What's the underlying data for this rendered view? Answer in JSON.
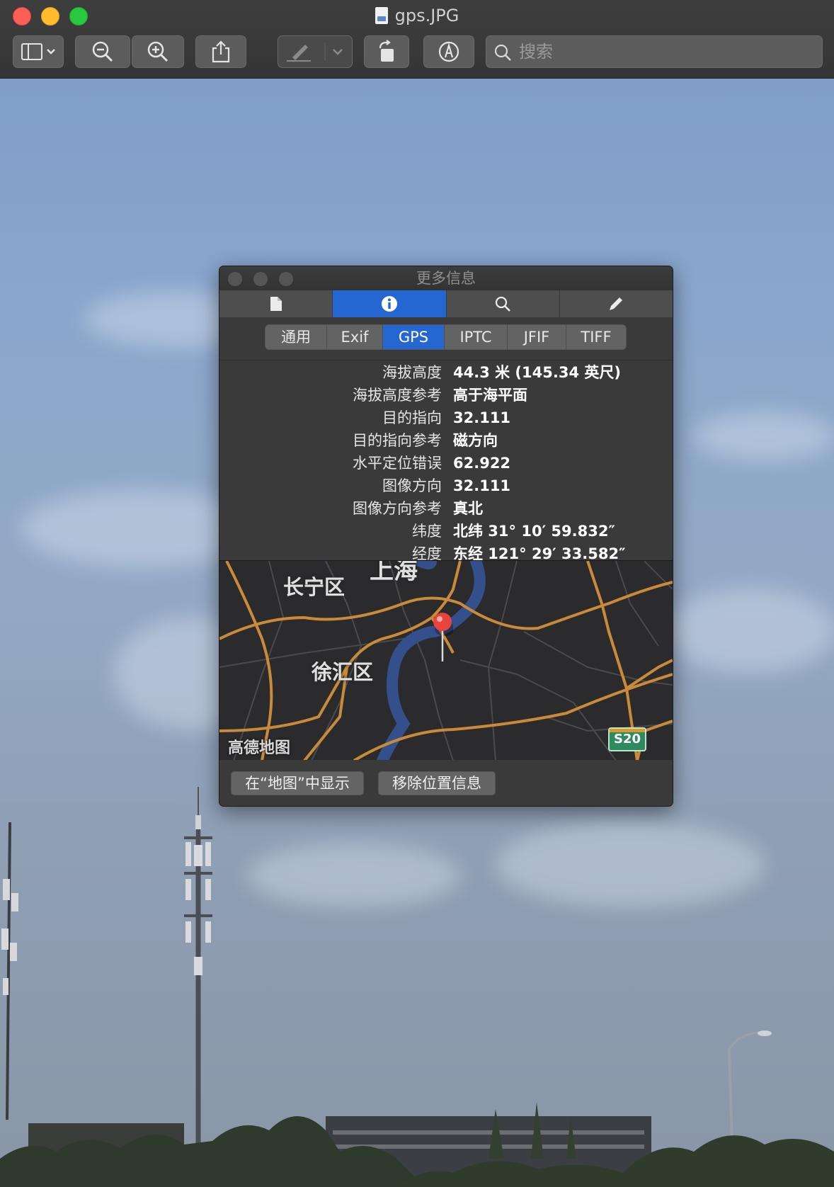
{
  "window": {
    "title": "gps.JPG",
    "search_placeholder": "搜索",
    "toolbar": [
      {
        "icon": "sidebar-toggle-icon"
      },
      {
        "icon": "zoom-out-icon"
      },
      {
        "icon": "zoom-in-icon"
      },
      {
        "icon": "share-icon"
      },
      {
        "icon": "markup-pen-icon"
      },
      {
        "icon": "rotate-icon"
      },
      {
        "icon": "annotate-icon"
      }
    ]
  },
  "inspector": {
    "title": "更多信息",
    "top_tabs": [
      {
        "icon": "document-icon",
        "active": false
      },
      {
        "icon": "info-icon",
        "active": true
      },
      {
        "icon": "magnifier-icon",
        "active": false
      },
      {
        "icon": "pencil-icon",
        "active": false
      }
    ],
    "sub_tabs": [
      "通用",
      "Exif",
      "GPS",
      "IPTC",
      "JFIF",
      "TIFF"
    ],
    "active_sub_tab": "GPS",
    "rows": [
      {
        "key": "海拔高度",
        "value": "44.3 米 (145.34 英尺)"
      },
      {
        "key": "海拔高度参考",
        "value": "高于海平面"
      },
      {
        "key": "目的指向",
        "value": "32.111"
      },
      {
        "key": "目的指向参考",
        "value": "磁方向"
      },
      {
        "key": "水平定位错误",
        "value": "62.922"
      },
      {
        "key": "图像方向",
        "value": "32.111"
      },
      {
        "key": "图像方向参考",
        "value": "真北"
      },
      {
        "key": "纬度",
        "value": "北纬 31° 10′ 59.832″"
      },
      {
        "key": "经度",
        "value": "东经 121° 29′ 33.582″"
      }
    ],
    "map": {
      "labels": {
        "top": "上海",
        "changning": "长宁区",
        "xuhui": "徐汇区"
      },
      "brand": "高德地图",
      "shield": "S20",
      "road_color": "#c98b3a",
      "river_color": "#34508c",
      "pin_color": "#e8433c"
    },
    "buttons": {
      "show_in_maps": "在“地图”中显示",
      "remove_location": "移除位置信息"
    }
  },
  "colors": {
    "accent": "#2467d2",
    "titlebar": "#3a3a3a",
    "panel": "#3a3a3a"
  }
}
